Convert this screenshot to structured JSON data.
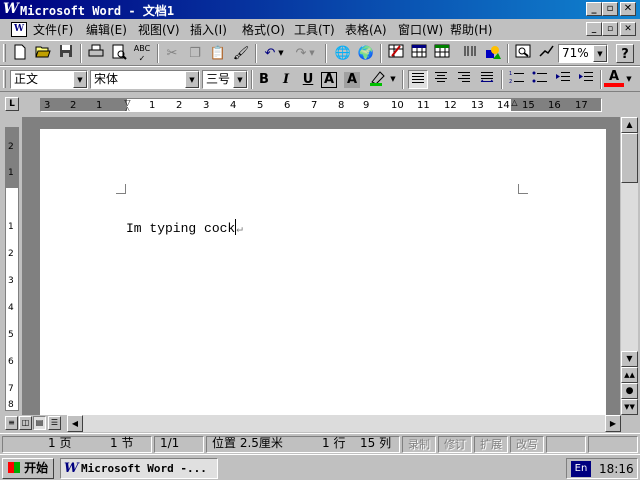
{
  "window": {
    "title": "Microsoft Word - 文档1",
    "app_icon": "W",
    "controls": {
      "minimize": "_",
      "maximize": "▫",
      "close": "✕"
    }
  },
  "menubar": {
    "items": [
      "文件(F)",
      "编辑(E)",
      "视图(V)",
      "插入(I)",
      "格式(O)",
      "工具(T)",
      "表格(A)",
      "窗口(W)",
      "帮助(H)"
    ],
    "doc_controls": {
      "minimize": "_",
      "restore": "▫",
      "close": "✕"
    }
  },
  "standard_toolbar": {
    "zoom": "71%",
    "help": "?"
  },
  "format_toolbar": {
    "style": "正文",
    "font": "宋体",
    "size": "三号",
    "bold": "B",
    "italic": "I",
    "underline": "U",
    "char_border": "A",
    "char_shading": "A",
    "font_color": "A"
  },
  "ruler": {
    "tab_selector": "L",
    "numbers": [
      "3",
      "2",
      "1",
      "1",
      "2",
      "3",
      "4",
      "5",
      "6",
      "7",
      "8",
      "9",
      "10",
      "11",
      "12",
      "13",
      "14",
      "15",
      "16",
      "17"
    ],
    "vertical_numbers": [
      "2",
      "1",
      "1",
      "2",
      "3",
      "4",
      "5",
      "6",
      "7",
      "8"
    ]
  },
  "document": {
    "text": "Im typing cock",
    "paragraph_mark": "↵"
  },
  "statusbar": {
    "page": "1 页",
    "section": "1 节",
    "pages": "1/1",
    "position": "位置 2.5厘米",
    "line": "1 行",
    "column": "15 列",
    "rec": "录制",
    "trk": "修订",
    "ext": "扩展",
    "ovr": "改写"
  },
  "taskbar": {
    "start": "开始",
    "task": "Microsoft Word -...",
    "ime": "En",
    "clock": "18:16"
  }
}
